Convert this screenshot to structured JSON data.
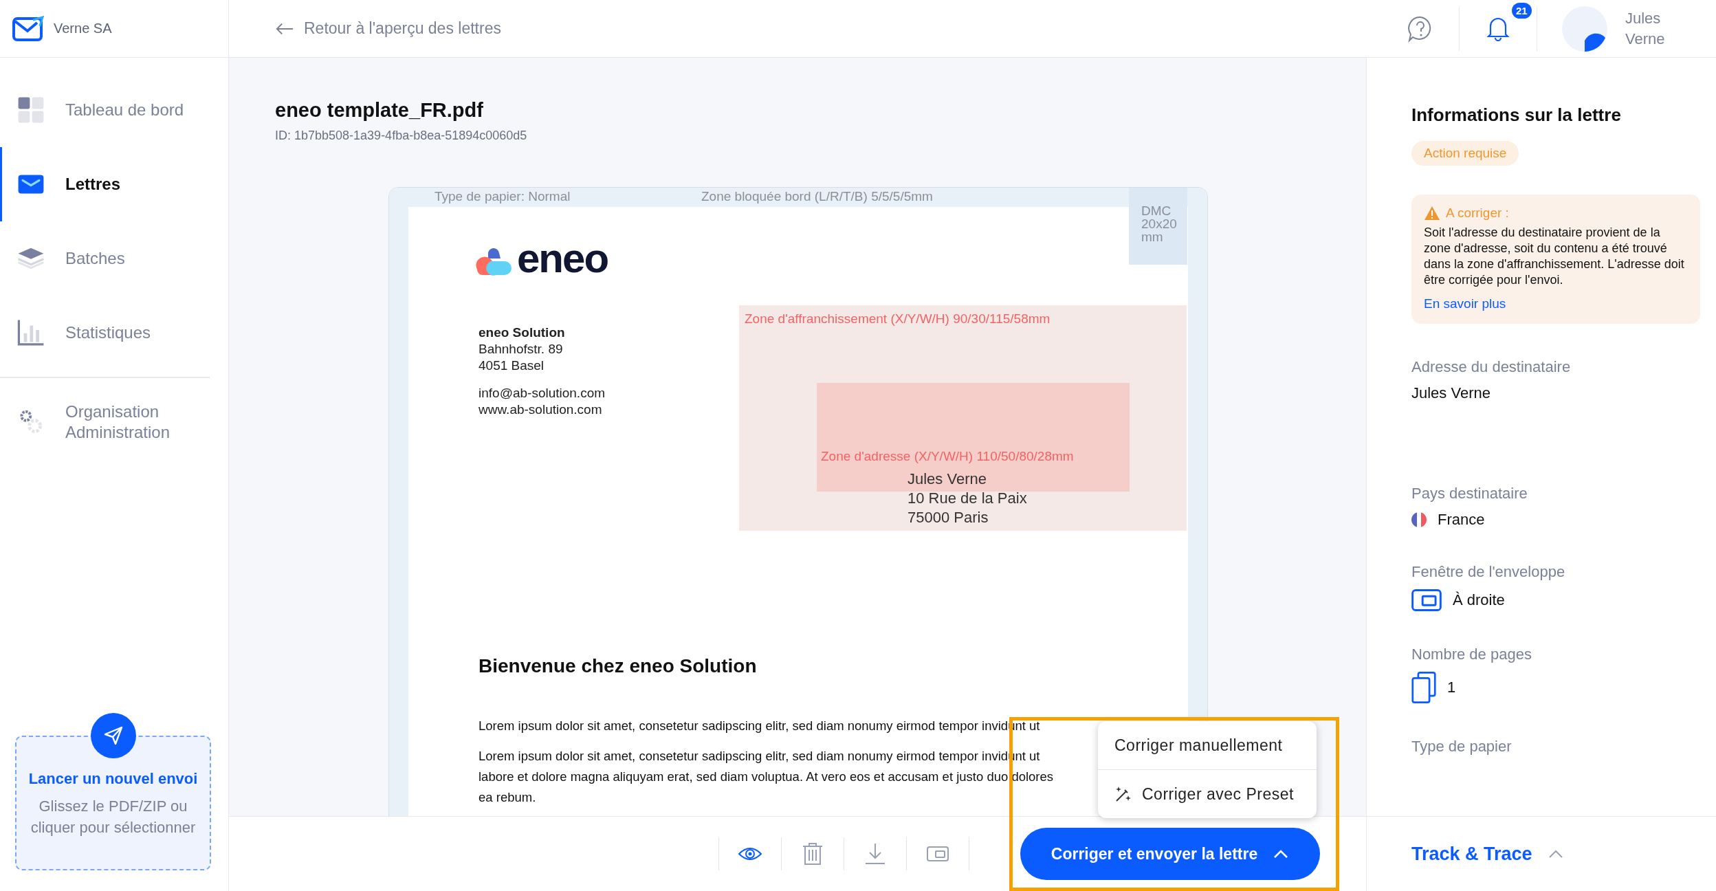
{
  "brand": {
    "name": "Verne SA"
  },
  "nav": [
    {
      "label": "Tableau de bord",
      "selected": false
    },
    {
      "label": "Lettres",
      "selected": true
    },
    {
      "label": "Batches",
      "selected": false
    },
    {
      "label": "Statistiques",
      "selected": false
    },
    {
      "label": "Organisation Administration",
      "selected": false
    }
  ],
  "new_send": {
    "title": "Lancer un nouvel envoi",
    "hint": "Glissez le PDF/ZIP ou cliquer pour sélectionner"
  },
  "header": {
    "back_link": "Retour à l'aperçu des lettres",
    "notification_count": "21",
    "user_name": "Jules Verne"
  },
  "document": {
    "filename": "eneo template_FR.pdf",
    "id": "ID: 1b7bb508-1a39-4fba-b8ea-51894c0060d5",
    "preview": {
      "paper_type": "Type de papier: Normal",
      "blocked_zone": "Zone bloquée bord (L/R/T/B) 5/5/5/5mm",
      "dmc": "DMC 20x20 mm",
      "logo_text": "eneo",
      "sender": [
        "eneo Solution",
        "Bahnhofstr. 89",
        "4051 Basel"
      ],
      "contact": [
        "info@ab-solution.com",
        "www.ab-solution.com"
      ],
      "franking_zone": "Zone d'affranchissement (X/Y/W/H) 90/30/115/58mm",
      "address_zone": "Zone d'adresse (X/Y/W/H) 110/50/80/28mm",
      "recipient": [
        "Jules Verne",
        "10 Rue de la Paix",
        "75000 Paris"
      ],
      "heading": "Bienvenue chez eneo Solution",
      "paragraphs": [
        [
          "Lorem ipsum dolor sit amet, consetetur sadipscing elitr, sed diam nonumy eirmod tempor invidunt ut"
        ],
        [
          "Lorem ipsum dolor sit amet, consetetur sadipscing elitr, sed diam nonumy eirmod tempor invidunt ut",
          "labore et dolore magna aliquyam erat, sed diam voluptua. At vero eos et accusam et justo duo dolores",
          "ea rebum."
        ]
      ]
    }
  },
  "menu": [
    {
      "label": "Corriger manuellement",
      "kind": "plain"
    },
    {
      "label": "Corriger avec Preset",
      "kind": "wand"
    }
  ],
  "primary_button": "Corriger et envoyer la lettre",
  "info": {
    "title": "Informations sur la lettre",
    "status": "Action requise",
    "alert": {
      "title": "A corriger :",
      "text": "Soit l'adresse du destinataire provient de la zone d'adresse, soit du contenu a été trouvé dans la zone d'affranchissement. L'adresse doit être corrigée pour l'envoi.",
      "link": "En savoir plus"
    },
    "fields": [
      {
        "label": "Adresse du destinataire",
        "value": "Jules Verne",
        "kind": "text"
      },
      {
        "label": "Pays destinataire",
        "value": "France",
        "kind": "flag"
      },
      {
        "label": "Fenêtre de l'enveloppe",
        "value": "À droite",
        "kind": "window"
      },
      {
        "label": "Nombre de pages",
        "value": "1",
        "kind": "pages"
      },
      {
        "label": "Type de papier",
        "kind": "text"
      }
    ]
  },
  "track_trace": "Track & Trace"
}
